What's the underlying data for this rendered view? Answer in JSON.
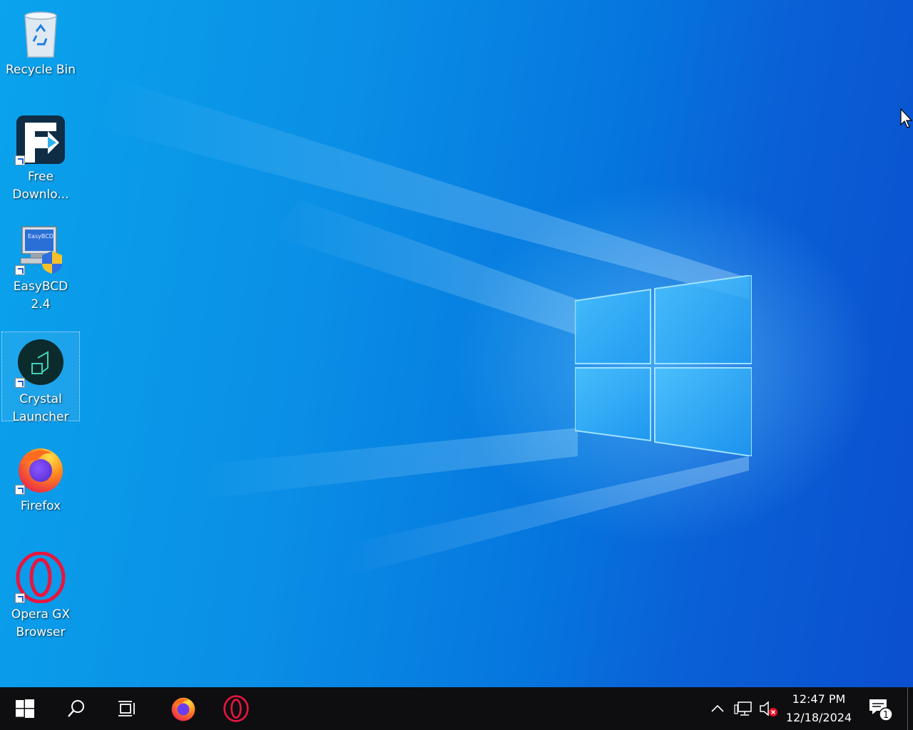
{
  "desktop": {
    "icons": [
      {
        "label": "Recycle Bin"
      },
      {
        "label": "Free Downlo..."
      },
      {
        "label": "EasyBCD 2.4"
      },
      {
        "label": "Crystal Launcher"
      },
      {
        "label": "Firefox"
      },
      {
        "label": "Opera GX Browser"
      }
    ],
    "easybcd_screen_text": "EasyBCD"
  },
  "taskbar": {
    "start_icon": "windows-logo-icon",
    "search_icon": "search-icon",
    "taskview_icon": "task-view-icon",
    "pinned": [
      "firefox-icon",
      "opera-gx-icon"
    ],
    "tray": {
      "time": "12:47 PM",
      "date": "12/18/2024",
      "notification_count": "1"
    }
  },
  "colors": {
    "taskbar": "#0e0e10",
    "desktop_accent": "#0a8fe6",
    "opera_red": "#e8153f"
  }
}
